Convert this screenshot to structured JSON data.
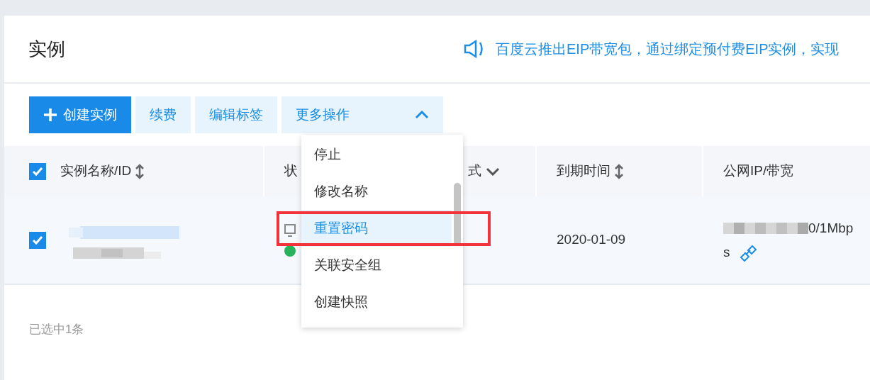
{
  "page": {
    "title": "实例",
    "notice": "百度云推出EIP带宽包，通过绑定预付费EIP实例，实现"
  },
  "toolbar": {
    "buttons": [
      {
        "label": "创建实例",
        "kind": "primary"
      },
      {
        "label": "续费",
        "kind": "plain"
      },
      {
        "label": "编辑标签",
        "kind": "plain"
      },
      {
        "label": "更多操作",
        "kind": "dropdown",
        "expanded": true
      }
    ]
  },
  "table": {
    "select_all": {
      "checked": true
    },
    "columns": [
      {
        "label": "实例名称/ID",
        "kind": "sortable"
      },
      {
        "label": "状",
        "kind": "plain"
      },
      {
        "label": "式",
        "kind": "filter"
      },
      {
        "label": "到期时间",
        "kind": "sortable"
      },
      {
        "label": "公网IP/带宽",
        "kind": "plain"
      }
    ],
    "rows": [
      {
        "checked": true,
        "color": "#27b35c",
        "expiry": "2020-01-09",
        "bandwidth_lines": [
          "0/1Mbp",
          "s"
        ]
      }
    ]
  },
  "dropdown": {
    "items": [
      {
        "label": "停止",
        "selected": false
      },
      {
        "label": "修改名称",
        "selected": false
      },
      {
        "label": "重置密码",
        "selected": true
      },
      {
        "label": "关联安全组",
        "selected": false
      },
      {
        "label": "创建快照",
        "selected": false
      }
    ]
  },
  "selection_summary": "已选中1条"
}
